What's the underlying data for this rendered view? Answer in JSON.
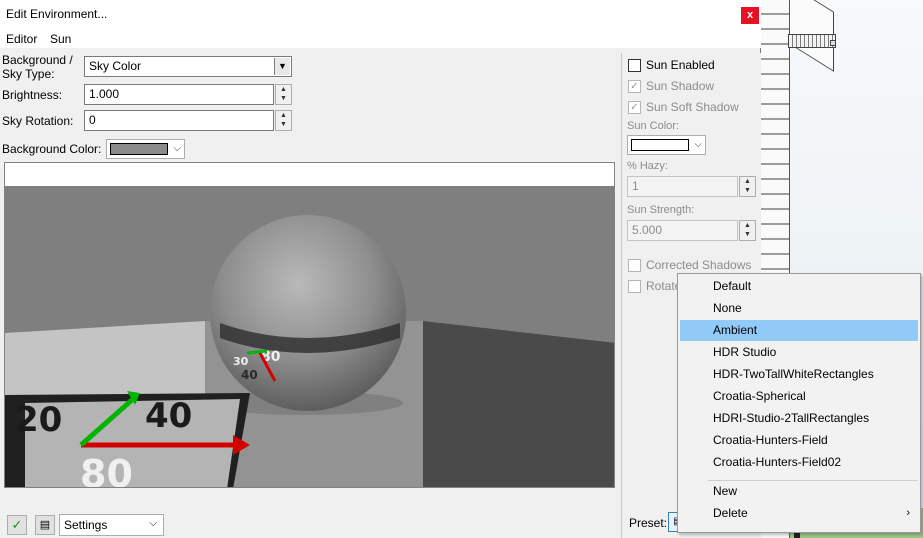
{
  "window": {
    "title": "Edit Environment...",
    "close_glyph": "x"
  },
  "menu": {
    "items": [
      "Editor",
      "Sun"
    ]
  },
  "background": {
    "type_label": "Background /\nSky Type:",
    "type_value": "Sky Color",
    "brightness_label": "Brightness:",
    "brightness_value": "1.000",
    "sky_rotation_label": "Sky Rotation:",
    "sky_rotation_value": "0",
    "color_label": "Background Color:",
    "color_value": "#8a8a8a"
  },
  "preview": {
    "tile_numbers": [
      "20",
      "40",
      "80"
    ],
    "sphere_numbers": [
      "30",
      "80",
      "40"
    ]
  },
  "sun": {
    "enabled_label": "Sun Enabled",
    "enabled": false,
    "shadow_label": "Sun Shadow",
    "shadow": true,
    "soft_shadow_label": "Sun Soft Shadow",
    "soft_shadow": true,
    "color_label": "Sun Color:",
    "color_value": "#ffffff",
    "hazy_label": "% Hazy:",
    "hazy_value": "1",
    "strength_label": "Sun Strength:",
    "strength_value": "5.000",
    "corrected_shadows_label": "Corrected Shadows",
    "rotate_label": "Rotate",
    "preset_label": "Preset:"
  },
  "preset_menu": {
    "items": [
      {
        "label": "Default",
        "active": false
      },
      {
        "label": "None",
        "active": false
      },
      {
        "label": "Ambient",
        "active": true
      },
      {
        "label": "HDR Studio",
        "active": false
      },
      {
        "label": "HDR-TwoTallWhiteRectangles",
        "active": false
      },
      {
        "label": "Croatia-Spherical",
        "active": false
      },
      {
        "label": "HDRI-Studio-2TallRectangles",
        "active": false
      },
      {
        "label": "Croatia-Hunters-Field",
        "active": false
      },
      {
        "label": "Croatia-Hunters-Field02",
        "active": false
      }
    ],
    "new_label": "New",
    "delete_label": "Delete",
    "delete_submenu_glyph": "›"
  },
  "bottom": {
    "ok_icon": "checkmark-icon",
    "settings_icon": "settings-dialog-icon",
    "settings_value": "Settings"
  },
  "icons": {
    "dropdown": "▼",
    "chevron": "⌵",
    "spin_up": "▲",
    "spin_down": "▼",
    "check": "✓"
  }
}
